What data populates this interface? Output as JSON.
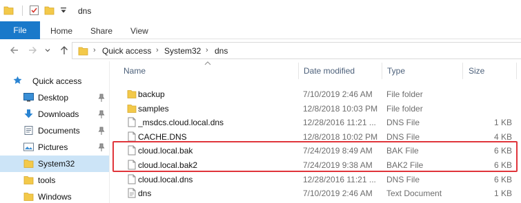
{
  "window": {
    "title": "dns"
  },
  "ribbon": {
    "file": "File",
    "home": "Home",
    "share": "Share",
    "view": "View"
  },
  "address": {
    "crumbs": [
      "Quick access",
      "System32",
      "dns"
    ]
  },
  "nav": {
    "items": [
      {
        "label": "Quick access",
        "icon": "star-icon",
        "pinned": false
      },
      {
        "label": "Desktop",
        "icon": "desktop-icon",
        "pinned": true
      },
      {
        "label": "Downloads",
        "icon": "download-icon",
        "pinned": true
      },
      {
        "label": "Documents",
        "icon": "documents-icon",
        "pinned": true
      },
      {
        "label": "Pictures",
        "icon": "pictures-icon",
        "pinned": true
      },
      {
        "label": "System32",
        "icon": "folder-icon",
        "pinned": false,
        "selected": true
      },
      {
        "label": "tools",
        "icon": "folder-icon",
        "pinned": false
      },
      {
        "label": "Windows",
        "icon": "folder-icon",
        "pinned": false
      }
    ]
  },
  "columns": {
    "name": "Name",
    "date": "Date modified",
    "type": "Type",
    "size": "Size"
  },
  "files": [
    {
      "name": "backup",
      "date": "7/10/2019 2:46 AM",
      "type": "File folder",
      "size": "",
      "kind": "folder"
    },
    {
      "name": "samples",
      "date": "12/8/2018 10:03 PM",
      "type": "File folder",
      "size": "",
      "kind": "folder"
    },
    {
      "name": "_msdcs.cloud.local.dns",
      "date": "12/28/2016 11:21 ...",
      "type": "DNS File",
      "size": "1 KB",
      "kind": "file"
    },
    {
      "name": "CACHE.DNS",
      "date": "12/8/2018 10:02 PM",
      "type": "DNS File",
      "size": "4 KB",
      "kind": "file"
    },
    {
      "name": "cloud.local.bak",
      "date": "7/24/2019 8:49 AM",
      "type": "BAK File",
      "size": "6 KB",
      "kind": "file"
    },
    {
      "name": "cloud.local.bak2",
      "date": "7/24/2019 9:38 AM",
      "type": "BAK2 File",
      "size": "6 KB",
      "kind": "file"
    },
    {
      "name": "cloud.local.dns",
      "date": "12/28/2016 11:21 ...",
      "type": "DNS File",
      "size": "6 KB",
      "kind": "file"
    },
    {
      "name": "dns",
      "date": "7/10/2019 2:46 AM",
      "type": "Text Document",
      "size": "1 KB",
      "kind": "text"
    }
  ],
  "colors": {
    "accent": "#1979ca",
    "highlight": "#e0343a",
    "folder": "#f3c94a"
  }
}
